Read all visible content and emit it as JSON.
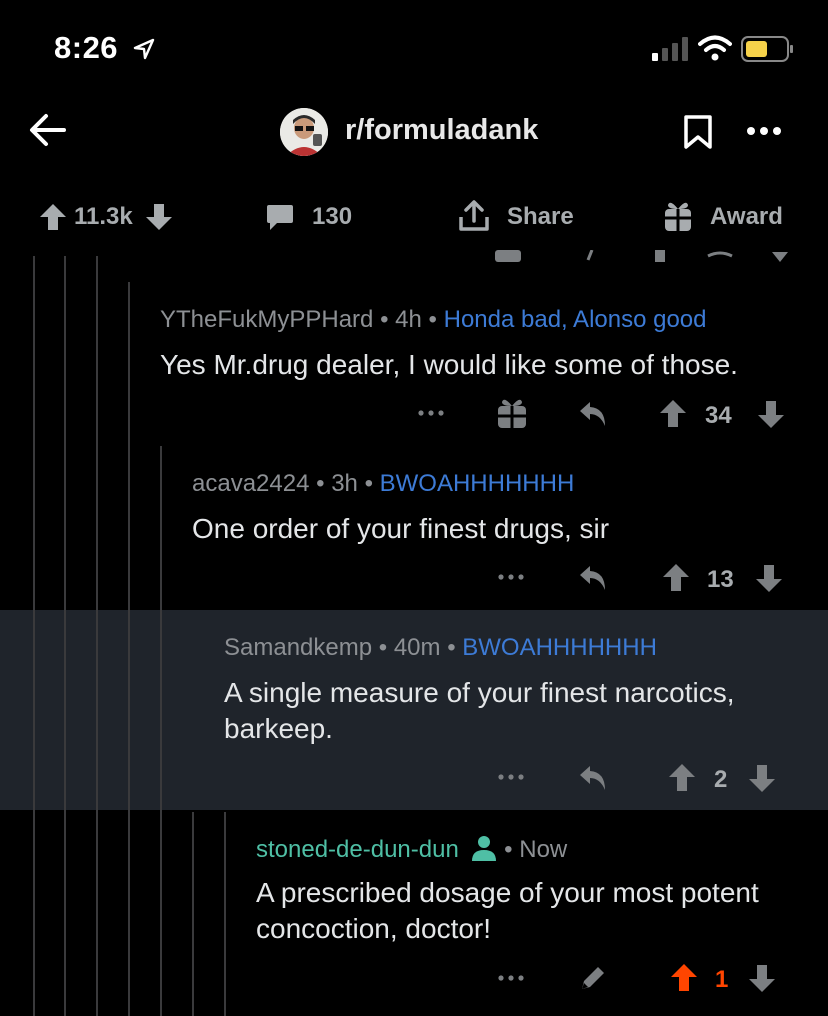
{
  "status": {
    "time": "8:26"
  },
  "header": {
    "subreddit": "r/formuladank"
  },
  "post_actions": {
    "score": "11.3k",
    "comments": "130",
    "share": "Share",
    "award": "Award"
  },
  "comments": [
    {
      "author": "YTheFukMyPPHard",
      "age": "4h",
      "flair": "Honda bad, Alonso good",
      "body": "Yes Mr.drug dealer, I would like some of those.",
      "score": "34"
    },
    {
      "author": "acava2424",
      "age": "3h",
      "flair": "BWOAHHHHHHH",
      "body": "One order of your finest drugs, sir",
      "score": "13"
    },
    {
      "author": "Samandkemp",
      "age": "40m",
      "flair": "BWOAHHHHHHH",
      "body": "A single measure of your finest narcotics, barkeep.",
      "score": "2"
    },
    {
      "author": "stoned-de-dun-dun",
      "age": "Now",
      "body": "A prescribed dosage of your most potent concoction, doctor!",
      "score": "1"
    }
  ],
  "colors": {
    "flair": "#3d7bd6",
    "op": "#4fbfa5",
    "upvoted": "#ff4500",
    "highlight": "#1f242b"
  }
}
